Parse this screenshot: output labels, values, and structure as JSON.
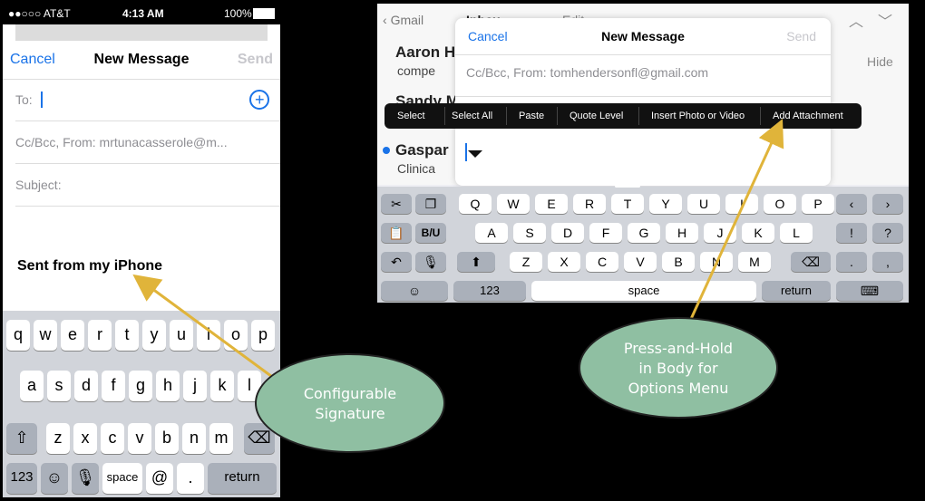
{
  "phone": {
    "status": {
      "carrier": "●●○○○ AT&T",
      "time": "4:13 AM",
      "battery": "100%"
    },
    "nav": {
      "cancel": "Cancel",
      "title": "New Message",
      "send": "Send"
    },
    "to_label": "To:",
    "cc_label": "Cc/Bcc, From:  mrtunacasserole@m...",
    "subject_label": "Subject:",
    "signature": "Sent from my iPhone",
    "keyboard": {
      "row1": [
        "q",
        "w",
        "e",
        "r",
        "t",
        "y",
        "u",
        "i",
        "o",
        "p"
      ],
      "row2": [
        "a",
        "s",
        "d",
        "f",
        "g",
        "h",
        "j",
        "k",
        "l"
      ],
      "row3": [
        "z",
        "x",
        "c",
        "v",
        "b",
        "n",
        "m"
      ],
      "numbers": "123",
      "space": "space",
      "at": "@",
      "dot": ".",
      "return": "return"
    }
  },
  "ipad": {
    "back": "Gmail",
    "inbox": "Inbox",
    "edit": "Edit",
    "hide": "Hide",
    "senders": [
      {
        "name": "Aaron H",
        "snippet": "compe"
      },
      {
        "name": "Sandy M",
        "snippet": ""
      },
      {
        "name": "Gaspar",
        "snippet": "Clinica"
      }
    ],
    "sheet": {
      "cancel": "Cancel",
      "title": "New Message",
      "send": "Send",
      "cc": "Cc/Bcc, From:  tomhendersonfl@gmail.com"
    },
    "menu": [
      "Select",
      "Select All",
      "Paste",
      "Quote Level",
      "Insert Photo or Video",
      "Add Attachment"
    ],
    "keyboard": {
      "row1": [
        "Q",
        "W",
        "E",
        "R",
        "T",
        "Y",
        "U",
        "I",
        "O",
        "P"
      ],
      "row2": [
        "A",
        "S",
        "D",
        "F",
        "G",
        "H",
        "J",
        "K",
        "L"
      ],
      "row3": [
        "Z",
        "X",
        "C",
        "V",
        "B",
        "N",
        "M"
      ],
      "numbers": "123",
      "space": "space",
      "return": "return",
      "bold": "B/U",
      "excl": "!",
      "q": "?",
      "dot": ".",
      "comma": ","
    }
  },
  "callouts": {
    "signature": [
      "Configurable",
      "Signature"
    ],
    "menu": [
      "Press-and-Hold",
      "in Body for",
      "Options Menu"
    ]
  },
  "colors": {
    "accent": "#1a73e8",
    "bubble": "#8fbfa2",
    "arrow": "#e0b43a"
  }
}
